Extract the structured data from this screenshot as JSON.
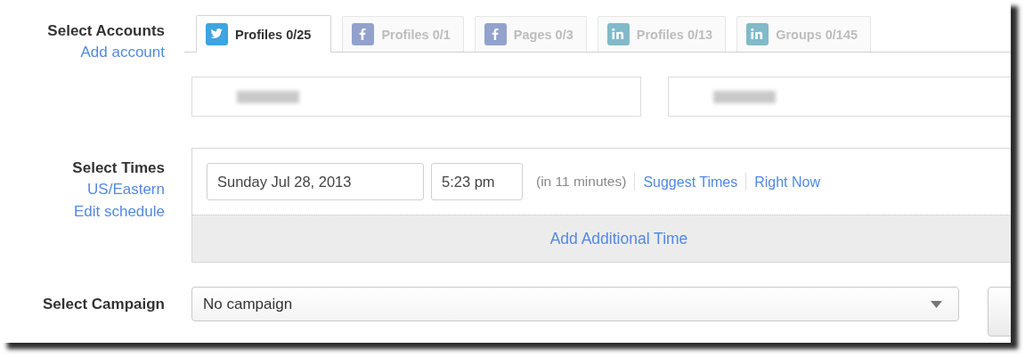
{
  "accounts": {
    "label": "Select Accounts",
    "link": "Add account",
    "tabs": [
      {
        "kind": "twitter",
        "label": "Profiles 0/25",
        "selected": true
      },
      {
        "kind": "facebook",
        "label": "Profiles 0/1",
        "selected": false
      },
      {
        "kind": "facebook",
        "label": "Pages 0/3",
        "selected": false
      },
      {
        "kind": "linkedin",
        "label": "Profiles 0/13",
        "selected": false
      },
      {
        "kind": "linkedin",
        "label": "Groups 0/145",
        "selected": false
      }
    ],
    "profiles": [
      {
        "kind": "blurred"
      },
      {
        "kind": "blurred"
      }
    ]
  },
  "times": {
    "label": "Select Times",
    "links": [
      "US/Eastern",
      "Edit schedule"
    ],
    "date": "Sunday Jul 28, 2013",
    "time": "5:23 pm",
    "relative": "(in 11 minutes)",
    "actions": [
      "Suggest Times",
      "Right Now"
    ],
    "add": "Add Additional Time"
  },
  "campaign": {
    "label": "Select Campaign",
    "value": "No campaign"
  }
}
